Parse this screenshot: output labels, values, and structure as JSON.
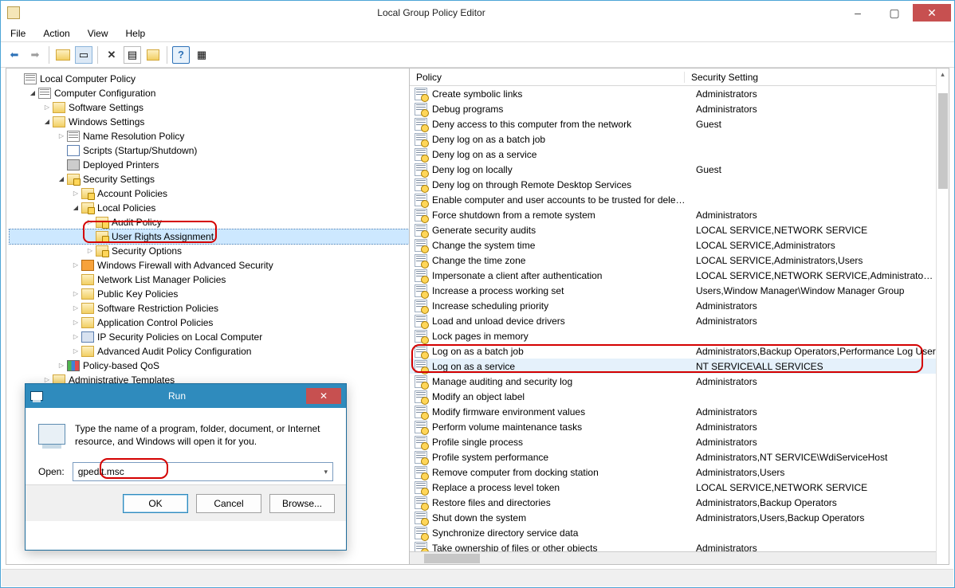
{
  "window": {
    "title": "Local Group Policy Editor",
    "minimize": "–",
    "maximize": "▢",
    "close": "✕"
  },
  "menu": {
    "file": "File",
    "action": "Action",
    "view": "View",
    "help": "Help"
  },
  "tree": [
    {
      "d": 0,
      "a": "none",
      "i": "policy",
      "t": "Local Computer Policy"
    },
    {
      "d": 1,
      "a": "open",
      "i": "policy",
      "t": "Computer Configuration"
    },
    {
      "d": 2,
      "a": "closed",
      "i": "folder",
      "t": "Software Settings"
    },
    {
      "d": 2,
      "a": "open",
      "i": "folder",
      "t": "Windows Settings"
    },
    {
      "d": 3,
      "a": "closed",
      "i": "policy",
      "t": "Name Resolution Policy"
    },
    {
      "d": 3,
      "a": "none",
      "i": "script",
      "t": "Scripts (Startup/Shutdown)"
    },
    {
      "d": 3,
      "a": "none",
      "i": "printer",
      "t": "Deployed Printers"
    },
    {
      "d": 3,
      "a": "open",
      "i": "folder-lock",
      "t": "Security Settings"
    },
    {
      "d": 4,
      "a": "closed",
      "i": "folder-lock",
      "t": "Account Policies"
    },
    {
      "d": 4,
      "a": "open",
      "i": "folder-lock",
      "t": "Local Policies"
    },
    {
      "d": 5,
      "a": "closed",
      "i": "folder-lock",
      "t": "Audit Policy"
    },
    {
      "d": 5,
      "a": "none",
      "i": "folder-lock",
      "t": "User Rights Assignment",
      "sel": true
    },
    {
      "d": 5,
      "a": "closed",
      "i": "folder-lock",
      "t": "Security Options"
    },
    {
      "d": 4,
      "a": "closed",
      "i": "firewall",
      "t": "Windows Firewall with Advanced Security"
    },
    {
      "d": 4,
      "a": "none",
      "i": "folder",
      "t": "Network List Manager Policies"
    },
    {
      "d": 4,
      "a": "closed",
      "i": "folder",
      "t": "Public Key Policies"
    },
    {
      "d": 4,
      "a": "closed",
      "i": "folder",
      "t": "Software Restriction Policies"
    },
    {
      "d": 4,
      "a": "closed",
      "i": "folder",
      "t": "Application Control Policies"
    },
    {
      "d": 4,
      "a": "closed",
      "i": "ipsec",
      "t": "IP Security Policies on Local Computer"
    },
    {
      "d": 4,
      "a": "closed",
      "i": "folder",
      "t": "Advanced Audit Policy Configuration"
    },
    {
      "d": 3,
      "a": "closed",
      "i": "qos",
      "t": "Policy-based QoS"
    },
    {
      "d": 2,
      "a": "closed",
      "i": "folder",
      "t": "Administrative Templates"
    }
  ],
  "list": {
    "col_policy": "Policy",
    "col_setting": "Security Setting",
    "rows": [
      {
        "p": "Create symbolic links",
        "s": "Administrators"
      },
      {
        "p": "Debug programs",
        "s": "Administrators"
      },
      {
        "p": "Deny access to this computer from the network",
        "s": "Guest"
      },
      {
        "p": "Deny log on as a batch job",
        "s": ""
      },
      {
        "p": "Deny log on as a service",
        "s": ""
      },
      {
        "p": "Deny log on locally",
        "s": "Guest"
      },
      {
        "p": "Deny log on through Remote Desktop Services",
        "s": ""
      },
      {
        "p": "Enable computer and user accounts to be trusted for delega...",
        "s": ""
      },
      {
        "p": "Force shutdown from a remote system",
        "s": "Administrators"
      },
      {
        "p": "Generate security audits",
        "s": "LOCAL SERVICE,NETWORK SERVICE"
      },
      {
        "p": "Change the system time",
        "s": "LOCAL SERVICE,Administrators"
      },
      {
        "p": "Change the time zone",
        "s": "LOCAL SERVICE,Administrators,Users"
      },
      {
        "p": "Impersonate a client after authentication",
        "s": "LOCAL SERVICE,NETWORK SERVICE,Administrators,SERV"
      },
      {
        "p": "Increase a process working set",
        "s": "Users,Window Manager\\Window Manager Group"
      },
      {
        "p": "Increase scheduling priority",
        "s": "Administrators"
      },
      {
        "p": "Load and unload device drivers",
        "s": "Administrators"
      },
      {
        "p": "Lock pages in memory",
        "s": ""
      },
      {
        "p": "Log on as a batch job",
        "s": "Administrators,Backup Operators,Performance Log User"
      },
      {
        "p": "Log on as a service",
        "s": "NT SERVICE\\ALL SERVICES",
        "sel": true
      },
      {
        "p": "Manage auditing and security log",
        "s": "Administrators"
      },
      {
        "p": "Modify an object label",
        "s": ""
      },
      {
        "p": "Modify firmware environment values",
        "s": "Administrators"
      },
      {
        "p": "Perform volume maintenance tasks",
        "s": "Administrators"
      },
      {
        "p": "Profile single process",
        "s": "Administrators"
      },
      {
        "p": "Profile system performance",
        "s": "Administrators,NT SERVICE\\WdiServiceHost"
      },
      {
        "p": "Remove computer from docking station",
        "s": "Administrators,Users"
      },
      {
        "p": "Replace a process level token",
        "s": "LOCAL SERVICE,NETWORK SERVICE"
      },
      {
        "p": "Restore files and directories",
        "s": "Administrators,Backup Operators"
      },
      {
        "p": "Shut down the system",
        "s": "Administrators,Users,Backup Operators"
      },
      {
        "p": "Synchronize directory service data",
        "s": ""
      },
      {
        "p": "Take ownership of files or other objects",
        "s": "Administrators"
      }
    ]
  },
  "run": {
    "title": "Run",
    "desc": "Type the name of a program, folder, document, or Internet resource, and Windows will open it for you.",
    "open_label": "Open:",
    "value": "gpedit.msc",
    "ok": "OK",
    "cancel": "Cancel",
    "browse": "Browse..."
  }
}
